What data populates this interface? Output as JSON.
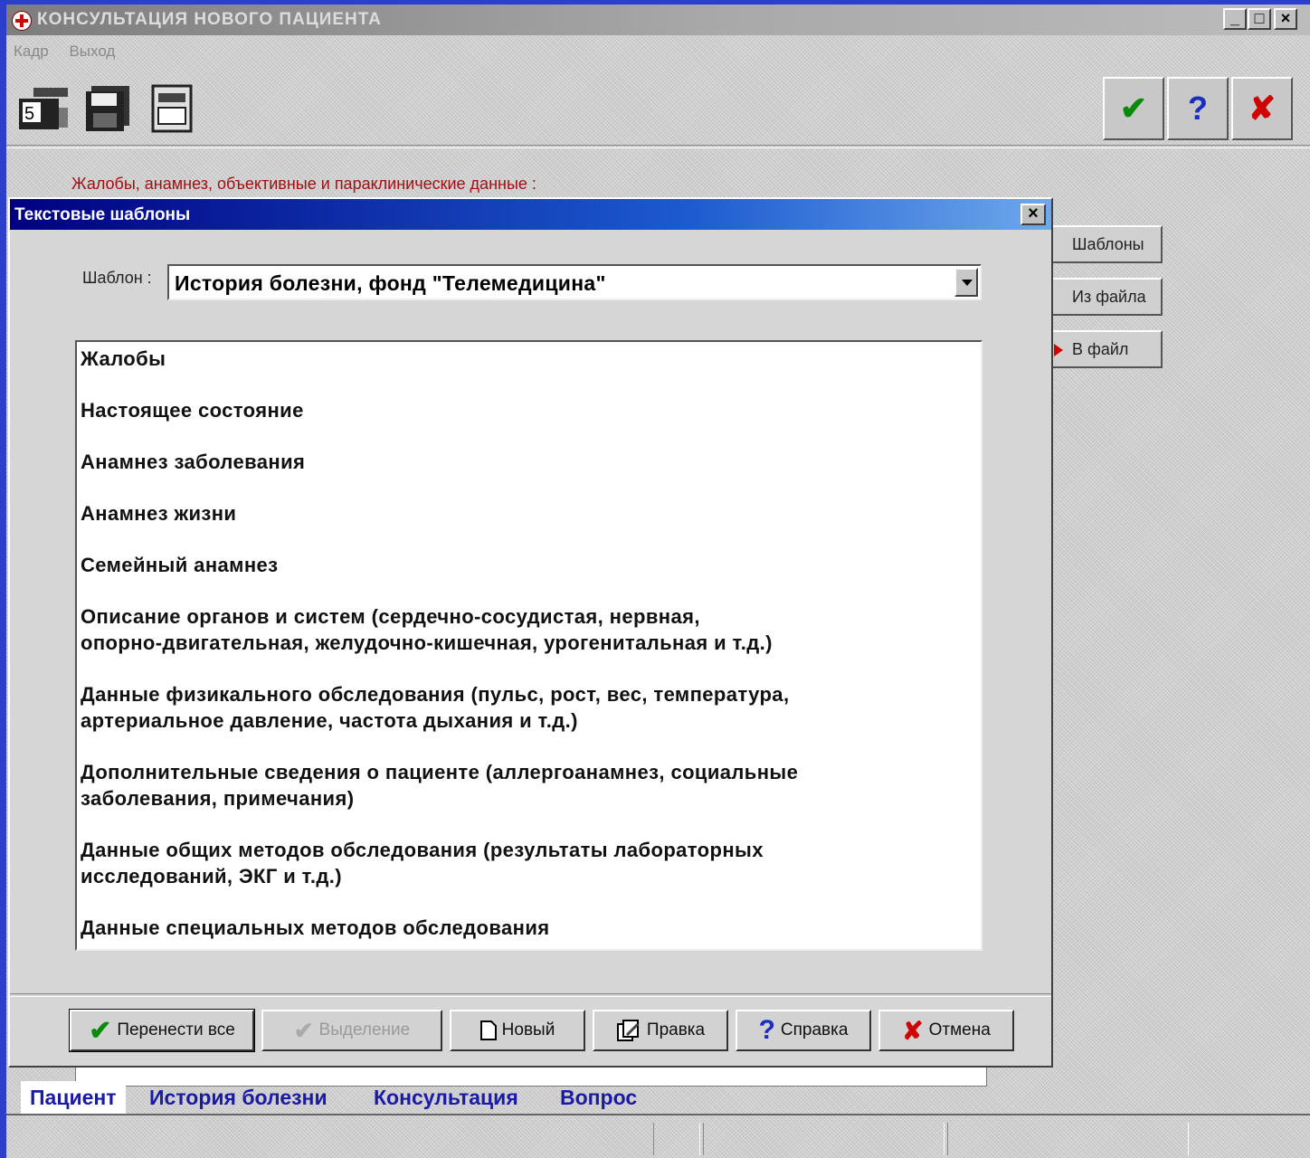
{
  "window": {
    "title": "КОНСУЛЬТАЦИЯ НОВОГО ПАЦИЕНТА",
    "minimize": "_",
    "maximize": "□",
    "close": "×"
  },
  "menu": {
    "items": [
      "Кадр",
      "Выход"
    ]
  },
  "toolbar": {
    "confirm_symbol": "✔",
    "help_symbol": "?",
    "cancel_symbol": "✘",
    "counter_badge": "5"
  },
  "main": {
    "complaints_label": "Жалобы, анамнез, объективные и параклинические данные :",
    "side_buttons": [
      "Шаблоны",
      "Из файла",
      "В файл"
    ]
  },
  "dialog": {
    "title": "Текстовые шаблоны",
    "close": "×",
    "template_label": "Шаблон :",
    "template_value": "История болезни, фонд \"Телемедицина\"",
    "template_lines": [
      "Жалобы",
      "Настоящее состояние",
      "Анамнез заболевания",
      "Анамнез жизни",
      "Семейный анамнез",
      "Описание органов и систем (сердечно-сосудистая, нервная,\nопорно-двигательная, желудочно-кишечная, урогенитальная и т.д.)",
      "Данные физикального обследования (пульс, рост, вес, температура,\nартериальное давление, частота дыхания и т.д.)",
      "Дополнительные сведения о пациенте (аллергоанамнез, социальные\nзаболевания, примечания)",
      "Данные общих методов обследования (результаты лабораторных\nисследований, ЭКГ и т.д.)",
      "Данные специальных методов обследования"
    ],
    "buttons": {
      "transfer_all": "Перенести все",
      "selection": "Выделение",
      "new": "Новый",
      "edit": "Правка",
      "help": "Справка",
      "cancel": "Отмена"
    }
  },
  "tabs": [
    "Пациент",
    "История болезни",
    "Консультация",
    "Вопрос"
  ],
  "colors": {
    "accent_red": "#a01010",
    "tab_blue": "#1a1aa6",
    "dialog_title": "#000080",
    "desktop": "#2a3fd0"
  }
}
